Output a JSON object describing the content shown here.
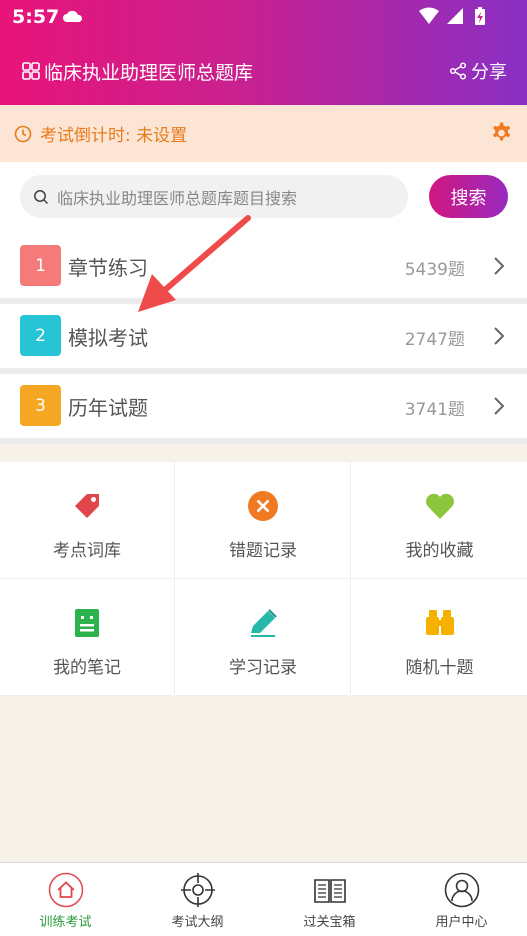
{
  "status": {
    "time": "5:57"
  },
  "app": {
    "title": "临床执业助理医师总题库",
    "share_label": "分享"
  },
  "countdown": {
    "text": "考试倒计时: 未设置"
  },
  "search": {
    "placeholder": "临床执业助理医师总题库题目搜索",
    "button_label": "搜索"
  },
  "categories": [
    {
      "num": "1",
      "label": "章节练习",
      "count": "5439题",
      "color": "#f57b7b"
    },
    {
      "num": "2",
      "label": "模拟考试",
      "count": "2747题",
      "color": "#27c4d6"
    },
    {
      "num": "3",
      "label": "历年试题",
      "count": "3741题",
      "color": "#f5a623"
    }
  ],
  "tools": [
    {
      "label": "考点词库",
      "icon": "tag-icon",
      "color": "#e0474c"
    },
    {
      "label": "错题记录",
      "icon": "close-circle-icon",
      "color": "#ef7a22"
    },
    {
      "label": "我的收藏",
      "icon": "heart-icon",
      "color": "#8cc63f"
    },
    {
      "label": "我的笔记",
      "icon": "note-icon",
      "color": "#2bb24c"
    },
    {
      "label": "学习记录",
      "icon": "pencil-icon",
      "color": "#26b8a8"
    },
    {
      "label": "随机十题",
      "icon": "binoculars-icon",
      "color": "#f5b000"
    }
  ],
  "nav": [
    {
      "label": "训练考试",
      "icon": "home-icon",
      "active": true
    },
    {
      "label": "考试大纲",
      "icon": "target-icon",
      "active": false
    },
    {
      "label": "过关宝箱",
      "icon": "book-icon",
      "active": false
    },
    {
      "label": "用户中心",
      "icon": "user-icon",
      "active": false
    }
  ],
  "colors": {
    "accent": "#d0177f",
    "countdown_text": "#e87b1a",
    "active_nav": "#2a9a3a",
    "annotation_arrow": "#ef4b4b"
  }
}
